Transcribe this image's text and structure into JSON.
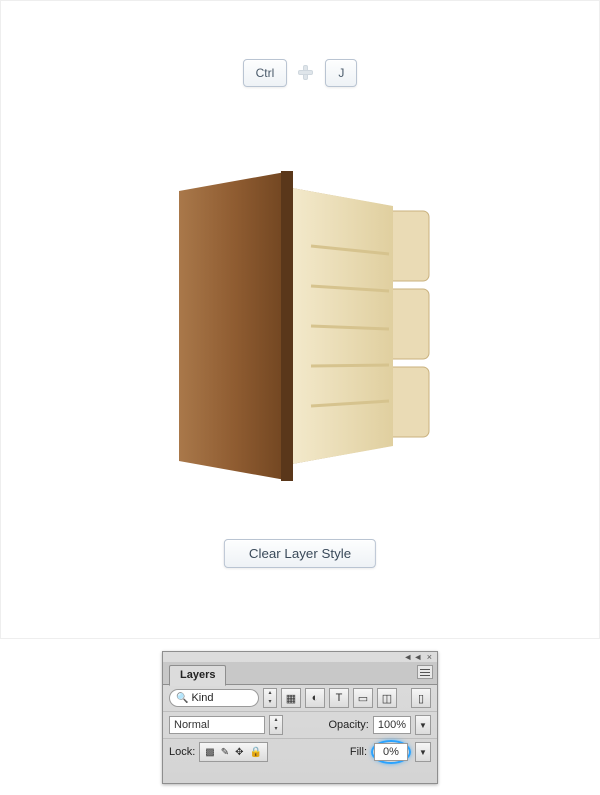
{
  "shortcut": {
    "key1": "Ctrl",
    "key2": "J"
  },
  "button": {
    "clear_layer_style": "Clear Layer Style"
  },
  "layers_panel": {
    "tab": "Layers",
    "filter_label": "Kind",
    "blend_mode": "Normal",
    "opacity_label": "Opacity:",
    "opacity_value": "100%",
    "lock_label": "Lock:",
    "fill_label": "Fill:",
    "fill_value": "0%"
  }
}
